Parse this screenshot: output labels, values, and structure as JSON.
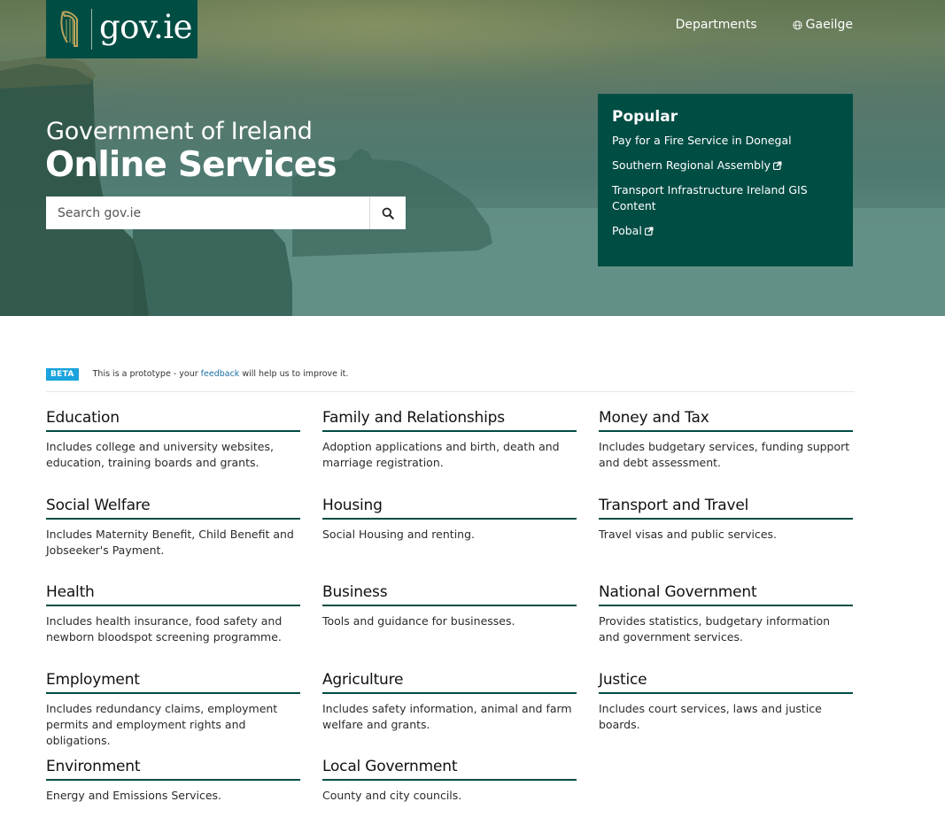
{
  "header": {
    "logo_text": "gov.ie",
    "nav": [
      {
        "label": "Departments"
      },
      {
        "label": "Gaeilge"
      }
    ]
  },
  "hero": {
    "subtitle": "Government of Ireland",
    "title": "Online Services",
    "search_placeholder": "Search gov.ie"
  },
  "popular": {
    "heading": "Popular",
    "links": [
      {
        "label": "Pay for a Fire Service in Donegal",
        "external": false
      },
      {
        "label": "Southern Regional Assembly",
        "external": true
      },
      {
        "label": "Transport Infrastructure Ireland GIS Content",
        "external": false
      },
      {
        "label": "Pobal",
        "external": true
      }
    ]
  },
  "beta": {
    "badge": "BETA",
    "text_before": "This is a prototype - your ",
    "link": "feedback",
    "text_after": " will help us to improve it."
  },
  "categories": [
    {
      "title": "Education",
      "desc": "Includes college and university websites, education, training boards and grants."
    },
    {
      "title": "Family and Relationships",
      "desc": "Adoption applications and birth, death and marriage registration."
    },
    {
      "title": "Money and Tax",
      "desc": "Includes budgetary services, funding support and debt assessment."
    },
    {
      "title": "Social Welfare",
      "desc": "Includes Maternity Benefit, Child Benefit and Jobseeker's Payment."
    },
    {
      "title": "Housing",
      "desc": "Social Housing and renting."
    },
    {
      "title": "Transport and Travel",
      "desc": "Travel visas and public services."
    },
    {
      "title": "Health",
      "desc": "Includes health insurance, food safety and newborn bloodspot screening programme."
    },
    {
      "title": "Business",
      "desc": "Tools and guidance for businesses."
    },
    {
      "title": "National Government",
      "desc": "Provides statistics, budgetary information and government services."
    },
    {
      "title": "Employment",
      "desc": "Includes redundancy claims, employment permits and employment rights and obligations."
    },
    {
      "title": "Agriculture",
      "desc": "Includes safety information, animal and farm welfare and grants."
    },
    {
      "title": "Justice",
      "desc": "Includes court services, laws and justice boards."
    },
    {
      "title": "Environment",
      "desc": "Energy and Emissions Services."
    },
    {
      "title": "Local Government",
      "desc": "County and city councils."
    }
  ],
  "colors": {
    "brand": "#004d44",
    "beta": "#1aa3dc"
  }
}
